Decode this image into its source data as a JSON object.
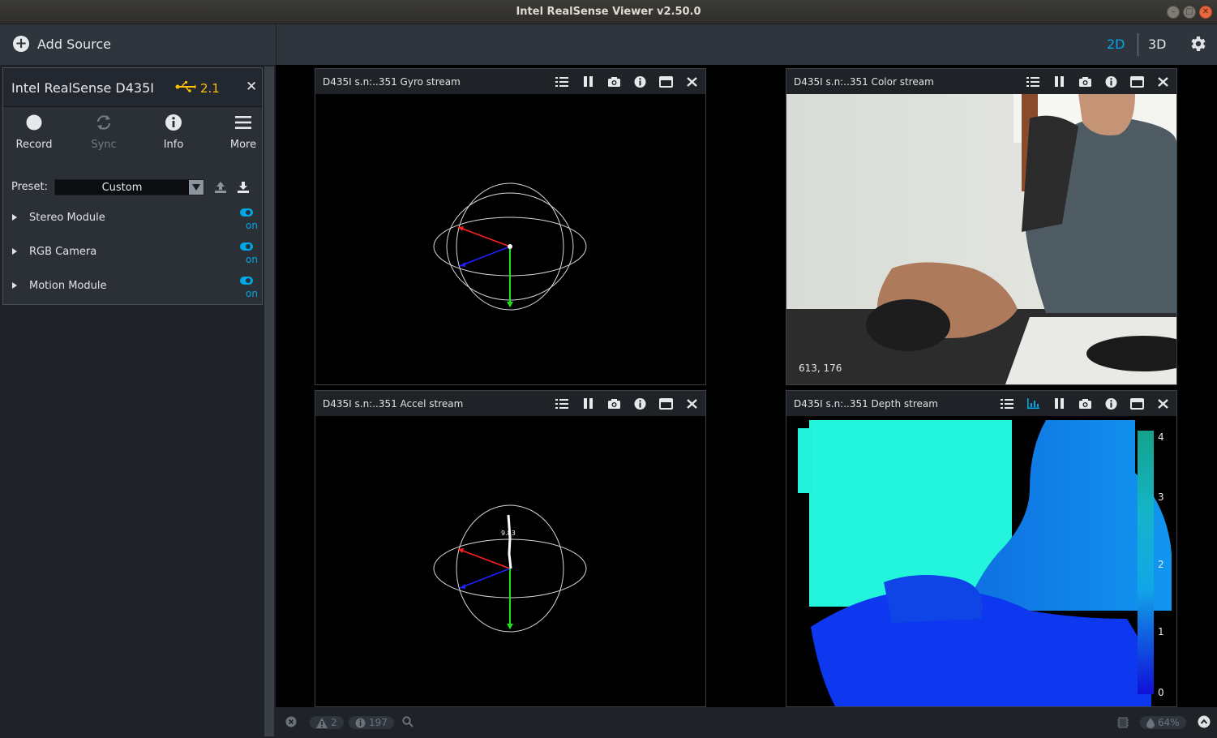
{
  "window": {
    "title": "Intel RealSense Viewer v2.50.0"
  },
  "topbar": {
    "add_source_label": "Add Source",
    "view_2d": "2D",
    "view_3d": "3D"
  },
  "device": {
    "name": "Intel RealSense D435I",
    "usb_version": "2.1",
    "actions": [
      {
        "label": "Record",
        "icon": "record-icon",
        "enabled": true
      },
      {
        "label": "Sync",
        "icon": "sync-icon",
        "enabled": false
      },
      {
        "label": "Info",
        "icon": "info-icon",
        "enabled": true
      },
      {
        "label": "More",
        "icon": "menu-icon",
        "enabled": true
      }
    ],
    "preset_label": "Preset:",
    "preset_value": "Custom",
    "modules": [
      {
        "label": "Stereo Module",
        "state": "on"
      },
      {
        "label": "RGB Camera",
        "state": "on"
      },
      {
        "label": "Motion Module",
        "state": "on"
      }
    ]
  },
  "streams": {
    "gyro": {
      "title": "D435I s.n:..351 Gyro stream"
    },
    "color": {
      "title": "D435I s.n:..351 Color stream",
      "cursor_readout": "613, 176"
    },
    "accel": {
      "title": "D435I s.n:..351 Accel stream",
      "magnitude": "9.83"
    },
    "depth": {
      "title": "D435I s.n:..351 Depth stream",
      "scale_ticks": [
        "4",
        "3",
        "2",
        "1",
        "0"
      ]
    }
  },
  "status": {
    "warnings": "2",
    "info_count": "197",
    "gpu_usage": "64%"
  },
  "colors": {
    "accent": "#00a8e6",
    "usb": "#ffc107",
    "panel": "#2f353d",
    "red_axis": "#ff2020",
    "green_axis": "#20e020",
    "blue_axis": "#2020ff"
  }
}
